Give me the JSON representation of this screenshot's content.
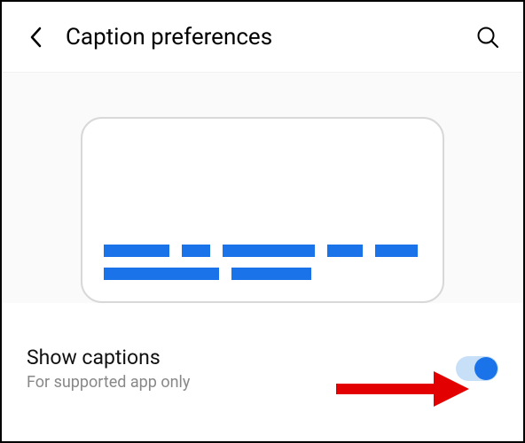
{
  "header": {
    "title": "Caption preferences"
  },
  "setting": {
    "label": "Show captions",
    "sublabel": "For supported app only",
    "enabled": true
  }
}
